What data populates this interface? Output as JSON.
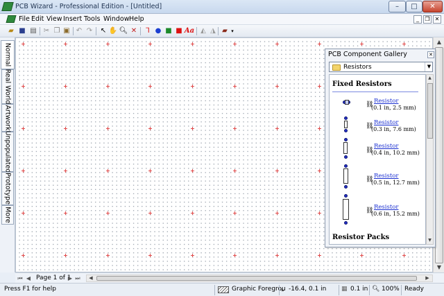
{
  "window": {
    "title": "PCB Wizard - Professional Edition - [Untitled]"
  },
  "menu": {
    "items": [
      "File",
      "Edit",
      "View",
      "Insert",
      "Tools",
      "Window",
      "Help"
    ]
  },
  "toolbar": {
    "buttons": [
      "open-icon",
      "save-icon",
      "print-icon",
      "cut-icon",
      "copy-icon",
      "paste-icon",
      "undo-icon",
      "redo-icon",
      "select-icon",
      "hand-icon",
      "zoom-icon",
      "delete-icon",
      "wire-icon",
      "pad-icon",
      "track-icon",
      "rectangle-icon",
      "text-icon",
      "flip-icon",
      "mirror-icon",
      "component-icon"
    ],
    "text_tool_label": "Aa"
  },
  "view_tabs": [
    "Normal",
    "Real World",
    "Artwork",
    "Unpopulated",
    "Prototype",
    "More"
  ],
  "gallery": {
    "title": "PCB Component Gallery",
    "category": "Resistors",
    "sections": [
      "Fixed Resistors",
      "Resistor Packs"
    ],
    "components": [
      {
        "name": "Resistor",
        "size": "(0.1 in, 2.5 mm)"
      },
      {
        "name": "Resistor",
        "size": "(0.3 in, 7.6 mm)"
      },
      {
        "name": "Resistor",
        "size": "(0.4 in, 10.2 mm)"
      },
      {
        "name": "Resistor",
        "size": "(0.5 in, 12.7 mm)"
      },
      {
        "name": "Resistor",
        "size": "(0.6 in, 15.2 mm)"
      }
    ]
  },
  "pager": {
    "label": "Page 1 of 1"
  },
  "status": {
    "help": "Press F1 for help",
    "layer": "Graphic Foregrou",
    "coords": "-16.4, 0.1 in",
    "grid": "0.1 in",
    "zoom": "100%",
    "state": "Ready"
  },
  "colors": {
    "accent": "#2330c8",
    "grid_cross": "#e04a4a",
    "link": "#1a2fd1"
  }
}
